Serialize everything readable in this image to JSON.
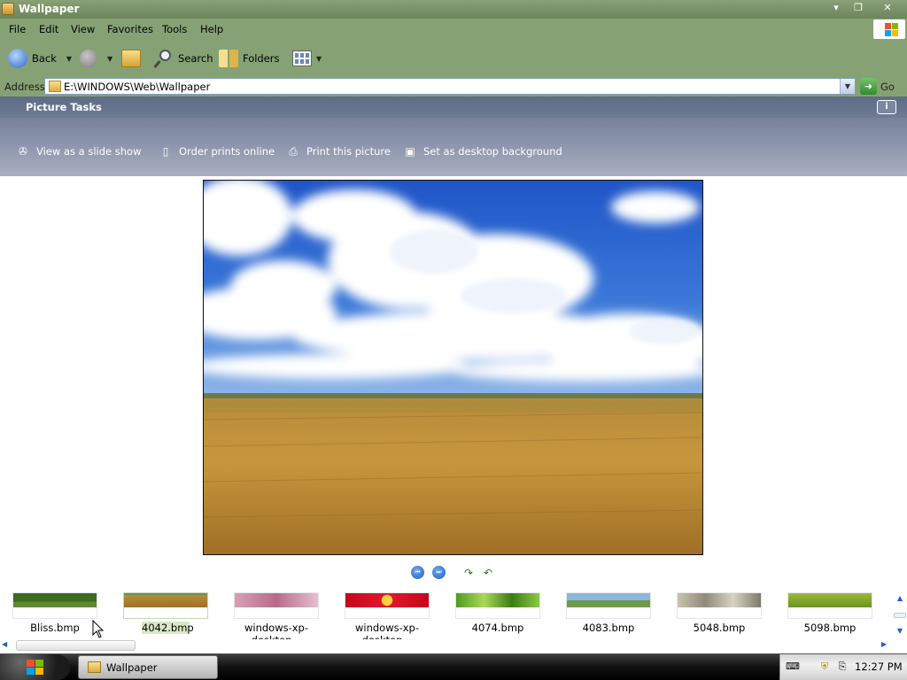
{
  "window": {
    "title": "Wallpaper",
    "controls": [
      "minimize",
      "restore",
      "close"
    ]
  },
  "menu": [
    "File",
    "Edit",
    "View",
    "Favorites",
    "Tools",
    "Help"
  ],
  "toolbar": {
    "back_label": "Back",
    "search_label": "Search",
    "folders_label": "Folders"
  },
  "address": {
    "label": "Address",
    "value": "E:\\WINDOWS\\Web\\Wallpaper",
    "go_label": "Go"
  },
  "tasks": {
    "title": "Picture Tasks",
    "info_glyph": "i",
    "items": [
      {
        "label": "View as a slide show",
        "icon": "slideshow-icon"
      },
      {
        "label": "Order prints online",
        "icon": "order-prints-icon"
      },
      {
        "label": "Print this picture",
        "icon": "print-icon"
      },
      {
        "label": "Set as desktop background",
        "icon": "desktop-icon"
      }
    ]
  },
  "filmstrip": {
    "items": [
      {
        "label": "Bliss.bmp",
        "selected": false
      },
      {
        "label": "4042.bmp",
        "selected": true
      },
      {
        "label": "windows-xp-desktop...",
        "selected": false
      },
      {
        "label": "windows-xp-desktop...",
        "selected": false
      },
      {
        "label": "4074.bmp",
        "selected": false
      },
      {
        "label": "4083.bmp",
        "selected": false
      },
      {
        "label": "5048.bmp",
        "selected": false
      },
      {
        "label": "5098.bmp",
        "selected": false
      }
    ]
  },
  "taskbar": {
    "window_button": "Wallpaper",
    "clock": "12:27 PM"
  },
  "colors": {
    "chrome_green": "#86a274",
    "task_pane": "#7d87a0",
    "selection": "#d8e8c4"
  }
}
